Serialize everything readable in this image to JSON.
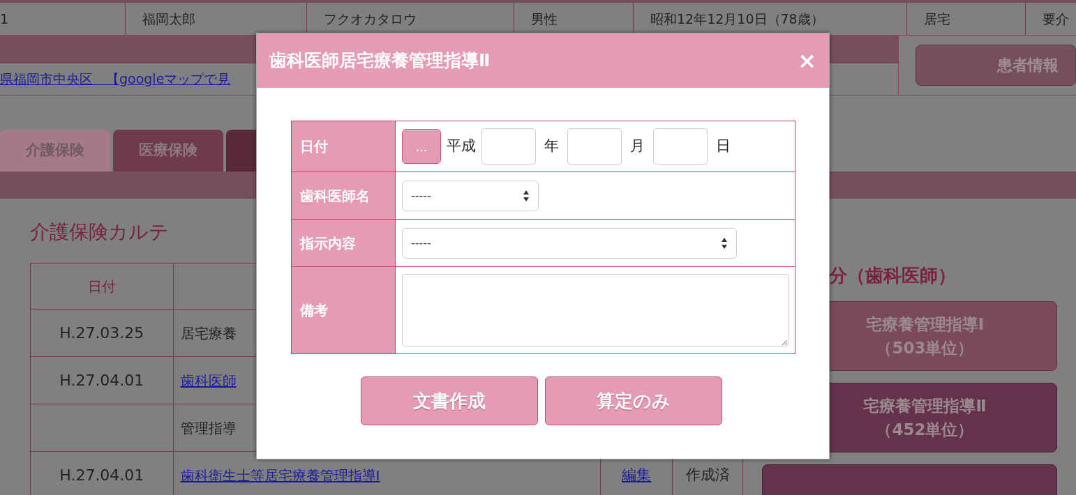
{
  "patient": {
    "cells": [
      "1",
      "福岡太郎",
      "フクオカタロウ",
      "男性",
      "昭和12年12月10日（78歳）",
      "居宅",
      "要介"
    ],
    "address_link": "県福岡市中央区　【googleマップで見",
    "info_button": "患者情報"
  },
  "tabs": [
    {
      "label": "介護保険",
      "selected": true
    },
    {
      "label": "医療保険",
      "selected": false
    },
    {
      "selected": false
    }
  ],
  "karte": {
    "title": "介護保険カルテ",
    "columns": [
      "日付"
    ],
    "rows": [
      {
        "date": "H.27.03.25",
        "content": "居宅療養",
        "link": false
      },
      {
        "date": "H.27.04.01",
        "content": "歯科医師",
        "link": true
      },
      {
        "content": "管理指導",
        "link": false
      },
      {
        "date": "H.27.04.01",
        "content": "歯科衛生士等居宅療養管理指導Ⅰ",
        "link": true,
        "edit": "編集",
        "status": "作成済"
      }
    ]
  },
  "side": {
    "heading": "分（歯科医師）",
    "buttons": [
      {
        "line1": "宅療養管理指導Ⅰ",
        "line2": "（503単位）",
        "selected": false
      },
      {
        "line1": "宅療養管理指導Ⅱ",
        "line2": "（452単位）",
        "selected": true
      },
      {
        "selected": true
      }
    ]
  },
  "dialog": {
    "title": "歯科医師居宅療養管理指導Ⅱ",
    "close": "×",
    "rows": [
      {
        "kind": "date",
        "label": "日付",
        "picker": "...",
        "era": "平成",
        "units": [
          "年",
          "月",
          "日"
        ]
      },
      {
        "kind": "select",
        "label": "歯科医師名",
        "value": "-----"
      },
      {
        "kind": "select_wide",
        "label": "指示内容",
        "value": "-----"
      },
      {
        "kind": "textarea",
        "label": "備考"
      }
    ],
    "buttons": [
      "文書作成",
      "算定のみ"
    ]
  }
}
